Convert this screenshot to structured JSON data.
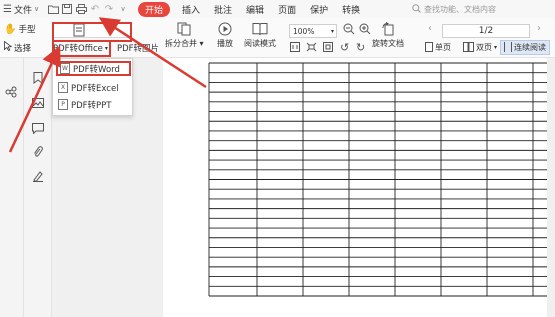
{
  "menubar": {
    "file_label": "文件",
    "tabs": [
      {
        "label": "开始",
        "active": true
      },
      {
        "label": "插入",
        "active": false
      },
      {
        "label": "批注",
        "active": false
      },
      {
        "label": "编辑",
        "active": false
      },
      {
        "label": "页面",
        "active": false
      },
      {
        "label": "保护",
        "active": false
      },
      {
        "label": "转换",
        "active": false
      }
    ],
    "search_placeholder": "查找功能、文档内容"
  },
  "toolbar": {
    "hand_label": "手型",
    "select_label": "选择",
    "pdf_to_office_label": "PDF转Office",
    "pdf_to_image_label": "PDF转图片",
    "split_merge_label": "拆分合并",
    "play_label": "播放",
    "read_mode_label": "阅读模式",
    "zoom_value": "100%",
    "page_indicator": "1/2",
    "rotate_doc_label": "旋转文档",
    "single_page_label": "单页",
    "double_page_label": "双页",
    "continuous_read_label": "连续阅读"
  },
  "dropdown": {
    "items": [
      {
        "label": "PDF转Word",
        "icon": "word-doc-icon",
        "highlighted": true
      },
      {
        "label": "PDF转Excel",
        "icon": "excel-doc-icon",
        "highlighted": false
      },
      {
        "label": "PDF转PPT",
        "icon": "ppt-doc-icon",
        "highlighted": false
      }
    ]
  },
  "colors": {
    "accent_red": "#e8453c",
    "annotation_red": "#d93a32",
    "toggle_active": "#dde7f5"
  }
}
